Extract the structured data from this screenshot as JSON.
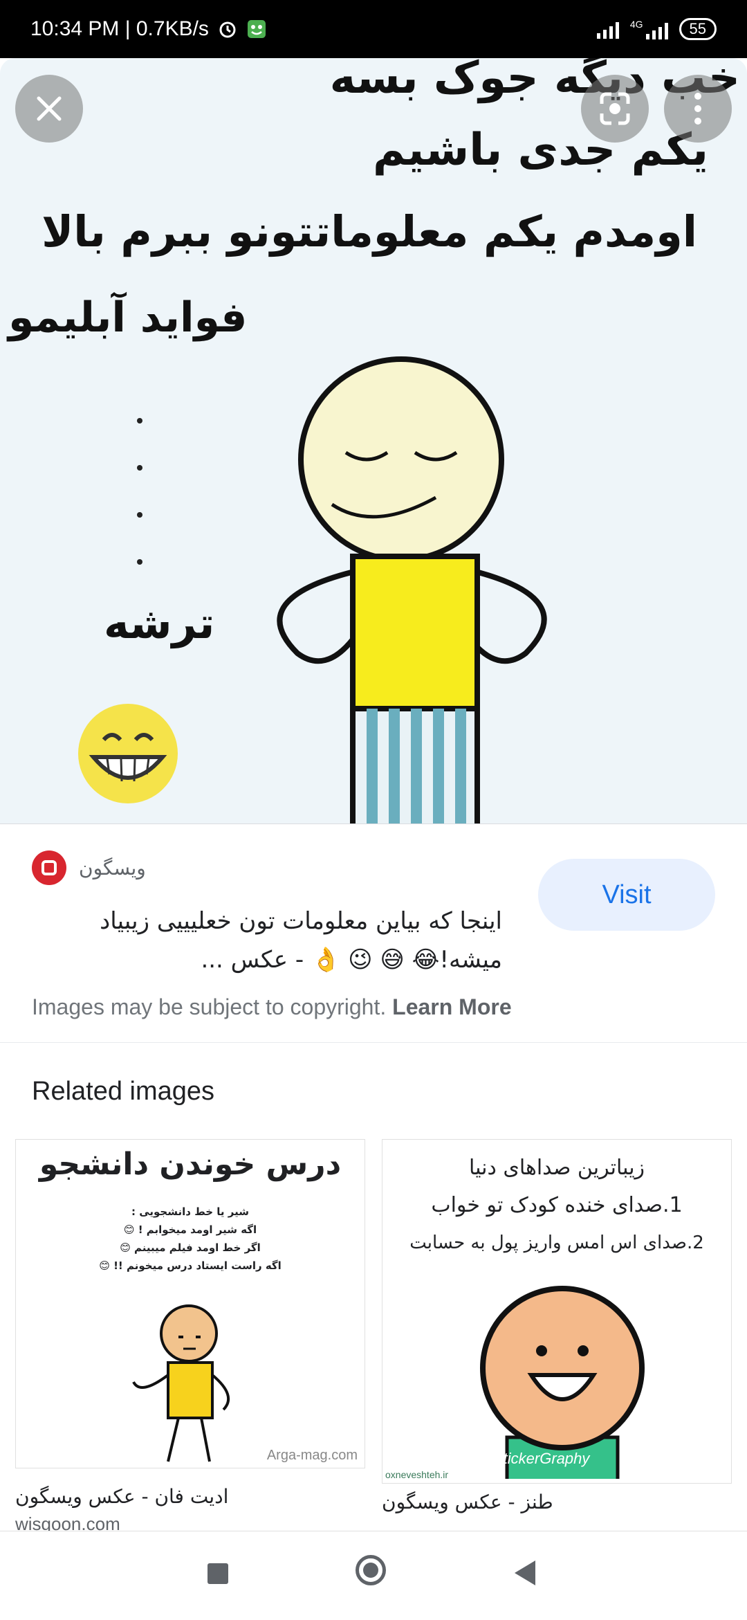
{
  "status_bar": {
    "time_speed": "10:34 PM | 0.7KB/s",
    "network": "4G",
    "battery": "55"
  },
  "hero": {
    "lines": [
      "خب دیگه جوک بسه",
      "یکم جدی باشیم",
      "اومدم یکم معلوماتتونو ببرم بالا",
      "فواید آبلیمو",
      "ترشه"
    ]
  },
  "info": {
    "site_name": "ویسگون",
    "title": "اینجا که بیاین معلومات تون خعلیییی زیبیاد میشه!😂 😅 😉 👌 - عکس ...",
    "visit_label": "Visit",
    "copyright_text": "Images may be subject to copyright.",
    "learn_more": "Learn More"
  },
  "related": {
    "heading": "Related images",
    "cards": [
      {
        "caption": "ادیت فان - عکس ویسگون",
        "domain": "wisgoon.com",
        "thumb_title": "درس خوندن دانشجو",
        "thumb_lines": [
          "شیر یا خط دانشجویی :",
          "اگه شیر اومد میخوابم ! 😊",
          "اگر خط اومد فیلم میبینم 😊",
          "اگه راست ایستاد درس میخونم !! 😊"
        ],
        "watermark": "Arga-mag.com"
      },
      {
        "caption": "طنز - عکس ویسگون",
        "thumb_lines": [
          "زیباترین صداهای دنیا",
          "1.صدای خنده کودک تو خواب",
          "2.صدای اس امس واریز پول به حسابت"
        ],
        "watermark": "StickerGraphy",
        "watermark2": "oxneveshteh.ir"
      }
    ]
  }
}
